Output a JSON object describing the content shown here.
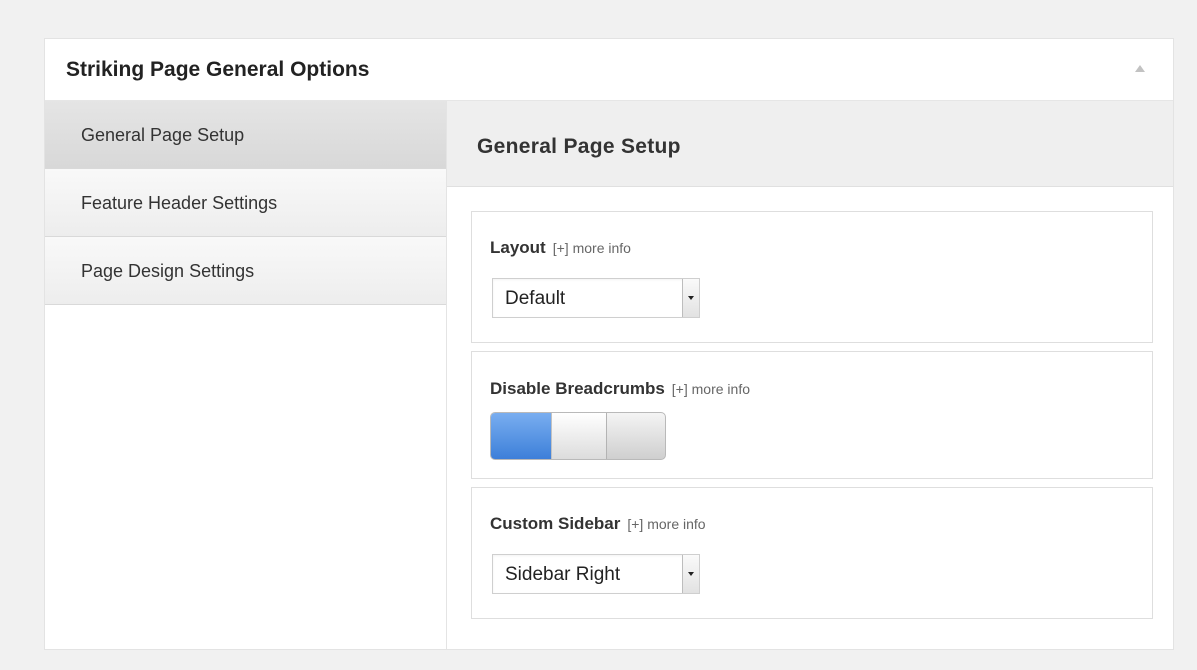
{
  "metabox": {
    "title": "Striking Page General Options",
    "collapse_icon": "triangle-up-icon"
  },
  "sidebar": {
    "items": [
      {
        "label": "General Page Setup",
        "active": true
      },
      {
        "label": "Feature Header Settings",
        "active": false
      },
      {
        "label": "Page Design Settings",
        "active": false
      }
    ]
  },
  "panel": {
    "title": "General Page Setup",
    "layout": {
      "label": "Layout",
      "more_info": "[+] more info",
      "value": "Default"
    },
    "breadcrumbs": {
      "label": "Disable Breadcrumbs",
      "more_info": "[+] more info",
      "toggle_state": "off"
    },
    "custom_sidebar": {
      "label": "Custom Sidebar",
      "more_info": "[+] more info",
      "value": "Sidebar Right"
    }
  },
  "colors": {
    "toggle_blue": "#3d7fd9",
    "active_tab": "#dedede",
    "panel_header": "#efefef"
  }
}
